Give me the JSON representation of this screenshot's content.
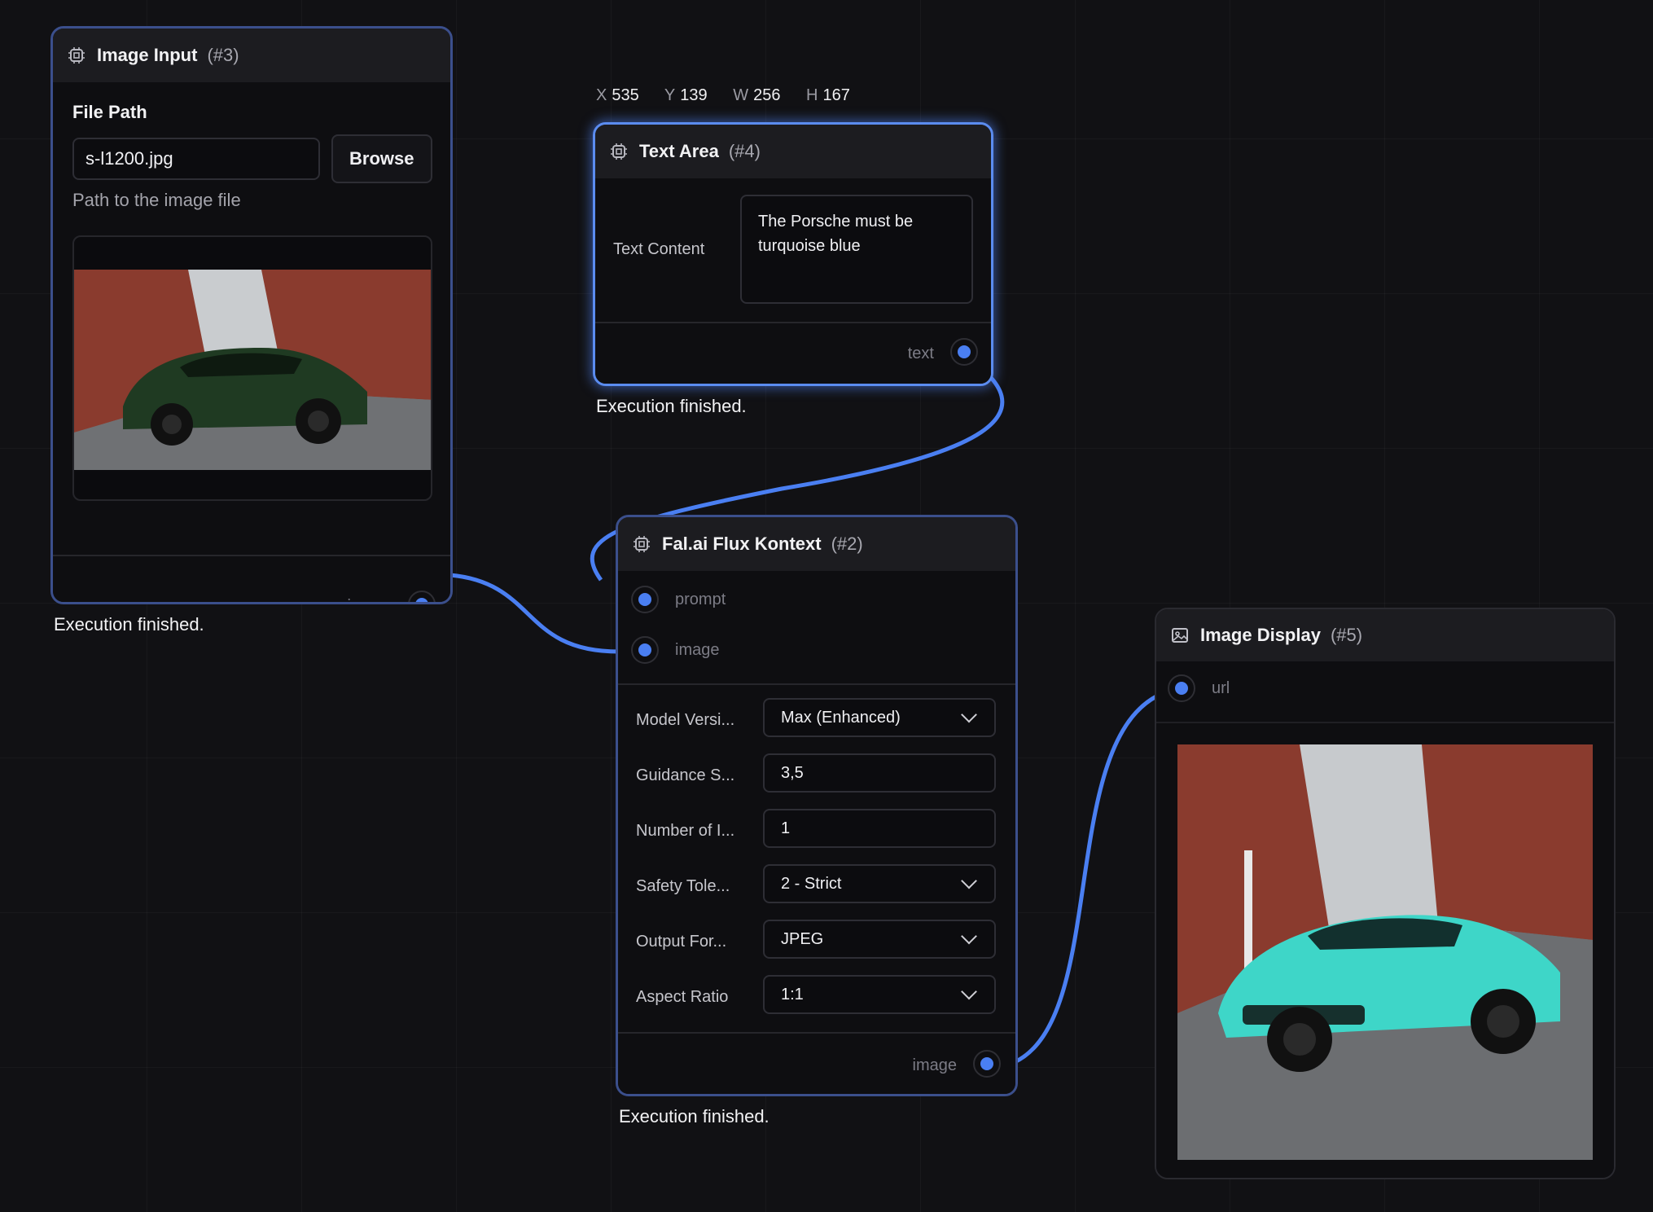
{
  "coords": {
    "x_label": "X",
    "x": "535",
    "y_label": "Y",
    "y": "139",
    "w_label": "W",
    "w": "256",
    "h_label": "H",
    "h": "167"
  },
  "image_input": {
    "title": "Image Input",
    "id": "(#3)",
    "field_label": "File Path",
    "file_value": "s-l1200.jpg",
    "browse_label": "Browse",
    "hint": "Path to the image file",
    "output_port": "image",
    "status": "Execution finished."
  },
  "text_area": {
    "title": "Text Area",
    "id": "(#4)",
    "content_label": "Text Content",
    "content_value": "The Porsche must be turquoise blue",
    "output_port": "text",
    "status": "Execution finished."
  },
  "flux": {
    "title": "Fal.ai Flux Kontext",
    "id": "(#2)",
    "input_ports": [
      "prompt",
      "image"
    ],
    "params": [
      {
        "label": "Model Versi...",
        "value": "Max (Enhanced)",
        "dropdown": true
      },
      {
        "label": "Guidance S...",
        "value": "3,5",
        "dropdown": false
      },
      {
        "label": "Number of I...",
        "value": "1",
        "dropdown": false
      },
      {
        "label": "Safety Tole...",
        "value": "2 - Strict",
        "dropdown": true
      },
      {
        "label": "Output For...",
        "value": "JPEG",
        "dropdown": true
      },
      {
        "label": "Aspect Ratio",
        "value": "1:1",
        "dropdown": true
      }
    ],
    "output_port": "image",
    "status": "Execution finished."
  },
  "image_display": {
    "title": "Image Display",
    "id": "(#5)",
    "input_port": "url"
  },
  "colors": {
    "accent": "#4a7ff2",
    "wire": "#4a7ff2",
    "node_border": "#3b4f8c",
    "selected_border": "#5b8cf0",
    "car_green": "#1f3a22",
    "car_turquoise": "#3ed6c8",
    "brick": "#8a3b2e"
  }
}
